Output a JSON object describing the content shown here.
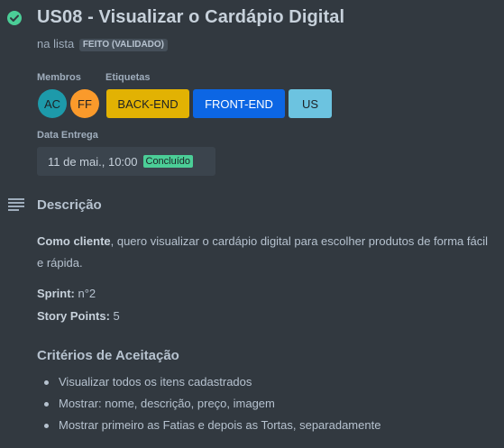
{
  "card": {
    "title": "US08 - Visualizar o Cardápio Digital",
    "list_prefix": "na lista",
    "list_name": "FEITO (VALIDADO)"
  },
  "members": {
    "label": "Membros",
    "items": [
      {
        "initials": "AC",
        "color": "#1d9aaa"
      },
      {
        "initials": "FF",
        "color": "#fa9a2b"
      }
    ]
  },
  "labels": {
    "label": "Etiquetas",
    "items": [
      {
        "text": "BACK-END",
        "color": "#e2b203",
        "text_color": "#1d2125"
      },
      {
        "text": "FRONT-END",
        "color": "#0c66e4",
        "text_color": "#ffffff"
      },
      {
        "text": "US",
        "color": "#6cc3e0",
        "text_color": "#1d2125"
      }
    ]
  },
  "due": {
    "label": "Data Entrega",
    "date": "11 de mai., 10:00",
    "status": "Concluído"
  },
  "description": {
    "title": "Descrição",
    "intro_bold": "Como cliente",
    "intro_rest": ", quero visualizar o cardápio digital para escolher produtos de forma fácil e rápida.",
    "sprint_label": "Sprint:",
    "sprint_value": " n°2",
    "points_label": "Story Points:",
    "points_value": " 5"
  },
  "criteria": {
    "title": "Critérios de Aceitação",
    "items": [
      "Visualizar todos os itens cadastrados",
      "Mostrar: nome, descrição, preço, imagem",
      "Mostrar primeiro as Fatias e depois as Tortas, separadamente"
    ]
  }
}
